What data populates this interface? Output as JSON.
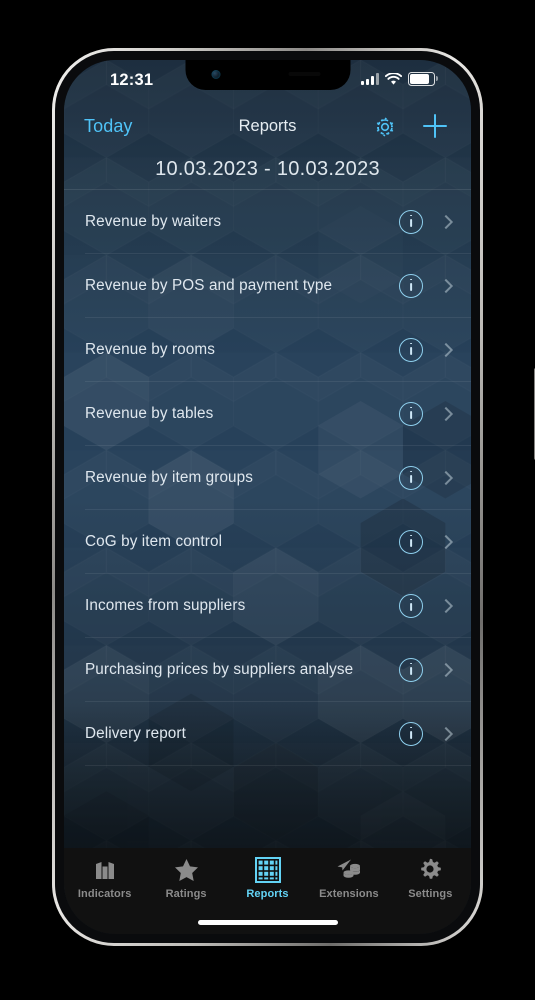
{
  "status_bar": {
    "time": "12:31",
    "signal_icon": "cellular-signal-icon",
    "wifi_icon": "wifi-icon",
    "battery_icon": "battery-icon"
  },
  "nav_bar": {
    "back_label": "Today",
    "title": "Reports",
    "settings_icon": "gear-icon",
    "add_icon": "plus-icon"
  },
  "date_range": {
    "value": "10.03.2023 - 10.03.2023"
  },
  "report_list": {
    "info_icon": "info-circle-icon",
    "chevron_icon": "chevron-right-icon",
    "items": [
      {
        "label": "Revenue by waiters"
      },
      {
        "label": "Revenue by POS and payment type"
      },
      {
        "label": "Revenue by rooms"
      },
      {
        "label": "Revenue by tables"
      },
      {
        "label": "Revenue by item groups"
      },
      {
        "label": "CoG by item control"
      },
      {
        "label": "Incomes from suppliers"
      },
      {
        "label": "Purchasing prices by suppliers analyse"
      },
      {
        "label": "Delivery report"
      }
    ]
  },
  "tab_bar": {
    "tabs": [
      {
        "label": "Indicators",
        "icon": "chart-bars-icon",
        "active": false
      },
      {
        "label": "Ratings",
        "icon": "star-icon",
        "active": false
      },
      {
        "label": "Reports",
        "icon": "grid-icon",
        "active": true
      },
      {
        "label": "Extensions",
        "icon": "paper-plane-coins-icon",
        "active": false
      },
      {
        "label": "Settings",
        "icon": "gear-icon",
        "active": false
      }
    ]
  },
  "colors": {
    "accent": "#4fc3f7",
    "active_tab": "#63d3f5",
    "inactive_tab": "#8b8b8b",
    "screen_top": "#1b2c3d",
    "screen_mid": "#27415a",
    "screen_bottom": "#111a21",
    "text_primary": "#dfe7ee",
    "tabbar_background": "#111111"
  }
}
